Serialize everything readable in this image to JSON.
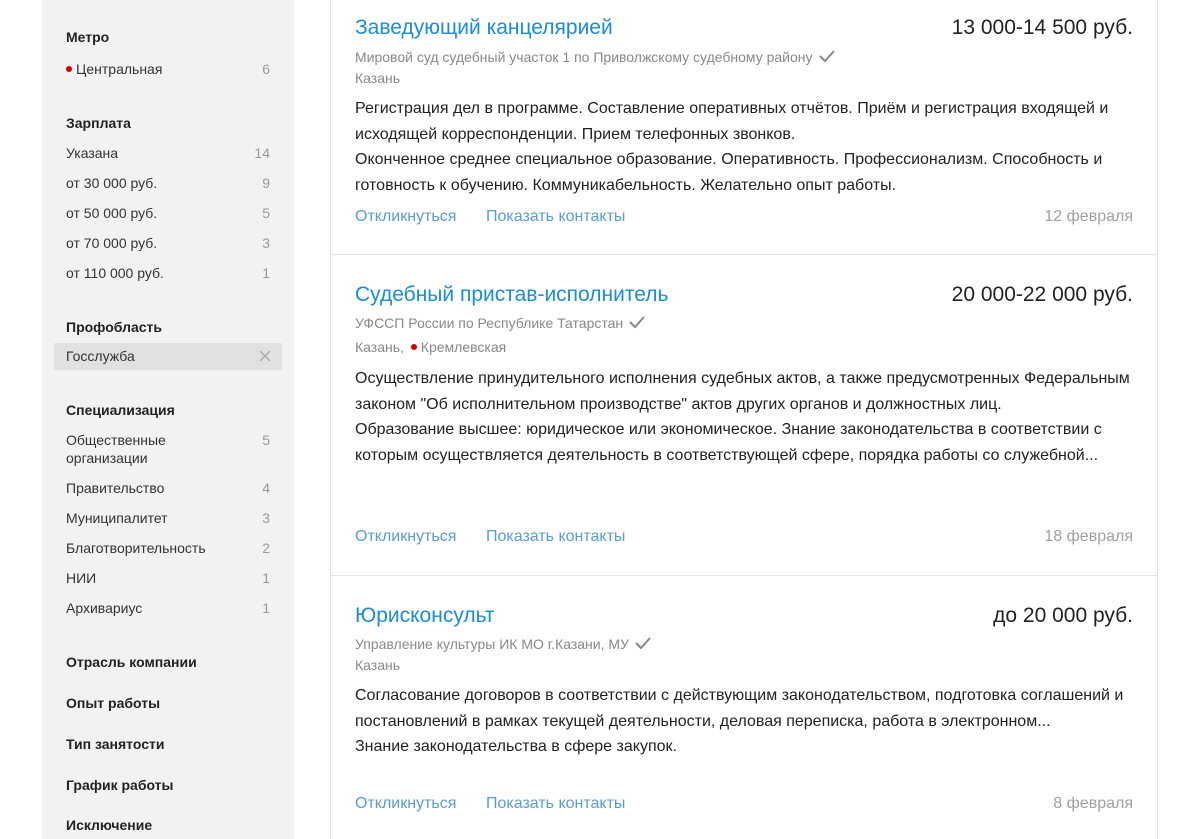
{
  "sidebar": {
    "metro": {
      "title": "Метро",
      "items": [
        {
          "label": "Центральная",
          "count": "6",
          "dot_color": "#d30000"
        }
      ]
    },
    "salary": {
      "title": "Зарплата",
      "items": [
        {
          "label": "Указана",
          "count": "14"
        },
        {
          "label": "от 30 000 руб.",
          "count": "9"
        },
        {
          "label": "от 50 000 руб.",
          "count": "5"
        },
        {
          "label": "от 70 000 руб.",
          "count": "3"
        },
        {
          "label": "от 110 000 руб.",
          "count": "1"
        }
      ]
    },
    "profarea": {
      "title": "Профобласть",
      "selected": "Госслужба"
    },
    "specialization": {
      "title": "Специализация",
      "items": [
        {
          "label": "Общественные организации",
          "count": "5"
        },
        {
          "label": "Правительство",
          "count": "4"
        },
        {
          "label": "Муниципалитет",
          "count": "3"
        },
        {
          "label": "Благотворительность",
          "count": "2"
        },
        {
          "label": "НИИ",
          "count": "1"
        },
        {
          "label": "Архивариус",
          "count": "1"
        }
      ]
    },
    "collapsed_sections": [
      "Отрасль компании",
      "Опыт работы",
      "Тип занятости",
      "График работы",
      "Исключение"
    ]
  },
  "vacancies": [
    {
      "title": "Заведующий канцелярией",
      "salary": "13 000-14 500 руб.",
      "company": "Мировой суд судебный участок 1 по Приволжскому судебному району",
      "location": "Казань",
      "metro": "",
      "description": [
        "Регистрация дел в программе. Составление оперативных отчётов. Приём и регистрация входящей и исходящей корреспонденции. Прием телефонных звонков.",
        "Оконченное среднее специальное образование. Оперативность. Профессионализм. Способность и готовность к обучению. Коммуникабельность. Желательно опыт работы."
      ],
      "respond_label": "Откликнуться",
      "contacts_label": "Показать контакты",
      "date": "12 февраля"
    },
    {
      "title": "Судебный пристав-исполнитель",
      "salary": "20 000-22 000 руб.",
      "company": "УФССП России по Республике Татарстан",
      "location": "Казань,",
      "metro": "Кремлевская",
      "description": [
        "Осуществление принудительного исполнения судебных актов, а также предусмотренных Федеральным законом \"Об исполнительном производстве\" актов других органов и должностных лиц.",
        "Образование высшее: юридическое или экономическое. Знание законодательства в соответствии с которым осуществляется деятельность в соответствующей сфере, порядка работы со служебной..."
      ],
      "respond_label": "Откликнуться",
      "contacts_label": "Показать контакты",
      "date": "18 февраля"
    },
    {
      "title": "Юрисконсульт",
      "salary": "до 20 000 руб.",
      "company": "Управление культуры ИК МО г.Казани, МУ",
      "location": "Казань",
      "metro": "",
      "description": [
        "Согласование договоров в соответствии с действующим законодательством, подготовка соглашений и постановлений в рамках текущей деятельности, деловая переписка, работа в электронном...",
        "Знание законодательства в сфере закупок."
      ],
      "respond_label": "Откликнуться",
      "contacts_label": "Показать контакты",
      "date": "8 февраля"
    }
  ],
  "colors": {
    "link": "#1a8cd8",
    "action_link": "#5b9bd5",
    "metro_dot": "#d30000",
    "sidebar_bg": "#f2f2f2"
  }
}
